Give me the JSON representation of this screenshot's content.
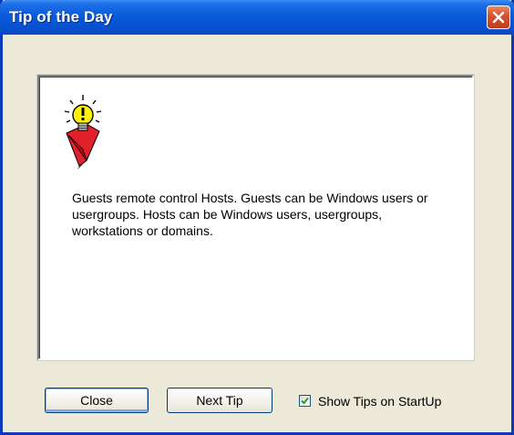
{
  "window": {
    "title": "Tip of the Day",
    "close_icon": "close-x-icon"
  },
  "tip": {
    "icon": "lightbulb-icon",
    "text": "Guests remote control Hosts. Guests can be Windows users or usergroups. Hosts can be Windows users, usergroups, workstations or domains."
  },
  "buttons": {
    "close_label": "Close",
    "next_label": "Next Tip"
  },
  "startup_option": {
    "label": "Show Tips on StartUp",
    "checked": true
  },
  "colors": {
    "titlebar_blue": "#0a5bd9",
    "close_red": "#d9532e",
    "dialog_face": "#ece9d8",
    "checkmark_green": "#21a121",
    "bulb_yellow": "#fff200",
    "bulb_red": "#e0202a"
  }
}
